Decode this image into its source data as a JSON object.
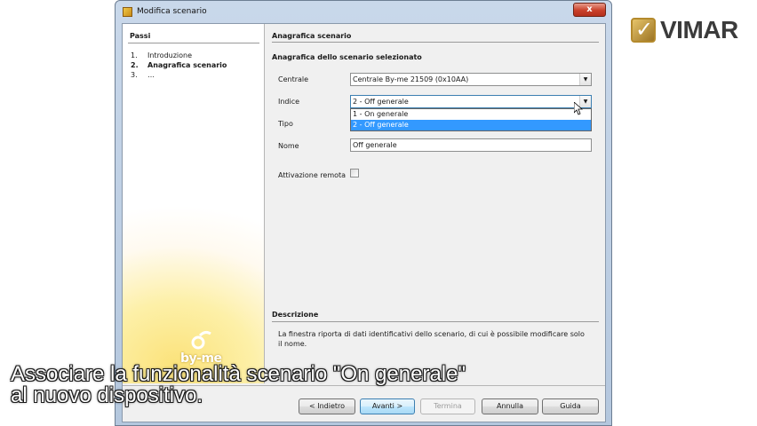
{
  "window": {
    "title": "Modifica scenario",
    "close_label": "x"
  },
  "steps": {
    "title": "Passi",
    "items": [
      {
        "num": "1.",
        "label": "Introduzione"
      },
      {
        "num": "2.",
        "label": "Anagrafica scenario"
      },
      {
        "num": "3.",
        "label": "…"
      }
    ]
  },
  "form": {
    "section_title": "Anagrafica scenario",
    "sub_title": "Anagrafica dello scenario selezionato",
    "centrale_label": "Centrale",
    "centrale_value": "Centrale By-me 21509 (0x10AA)",
    "indice_label": "Indice",
    "indice_value": "2 - Off generale",
    "indice_options": [
      "1 - On generale",
      "2 - Off generale"
    ],
    "tipo_label": "Tipo",
    "nome_label": "Nome",
    "nome_value": "Off generale",
    "attivazione_label": "Attivazione remota"
  },
  "description": {
    "title": "Descrizione",
    "text": "La finestra riporta di dati identificativi dello scenario, di cui è possibile modificare solo il nome."
  },
  "buttons": {
    "back": "< Indietro",
    "next": "Avanti >",
    "finish": "Termina",
    "cancel": "Annulla",
    "help": "Guida"
  },
  "branding": {
    "vimar": "VIMAR",
    "byme": "by-me"
  },
  "caption": {
    "line1": "Associare la funzionalità scenario \"On generale\"",
    "line2": "al nuovo dispositivo."
  }
}
